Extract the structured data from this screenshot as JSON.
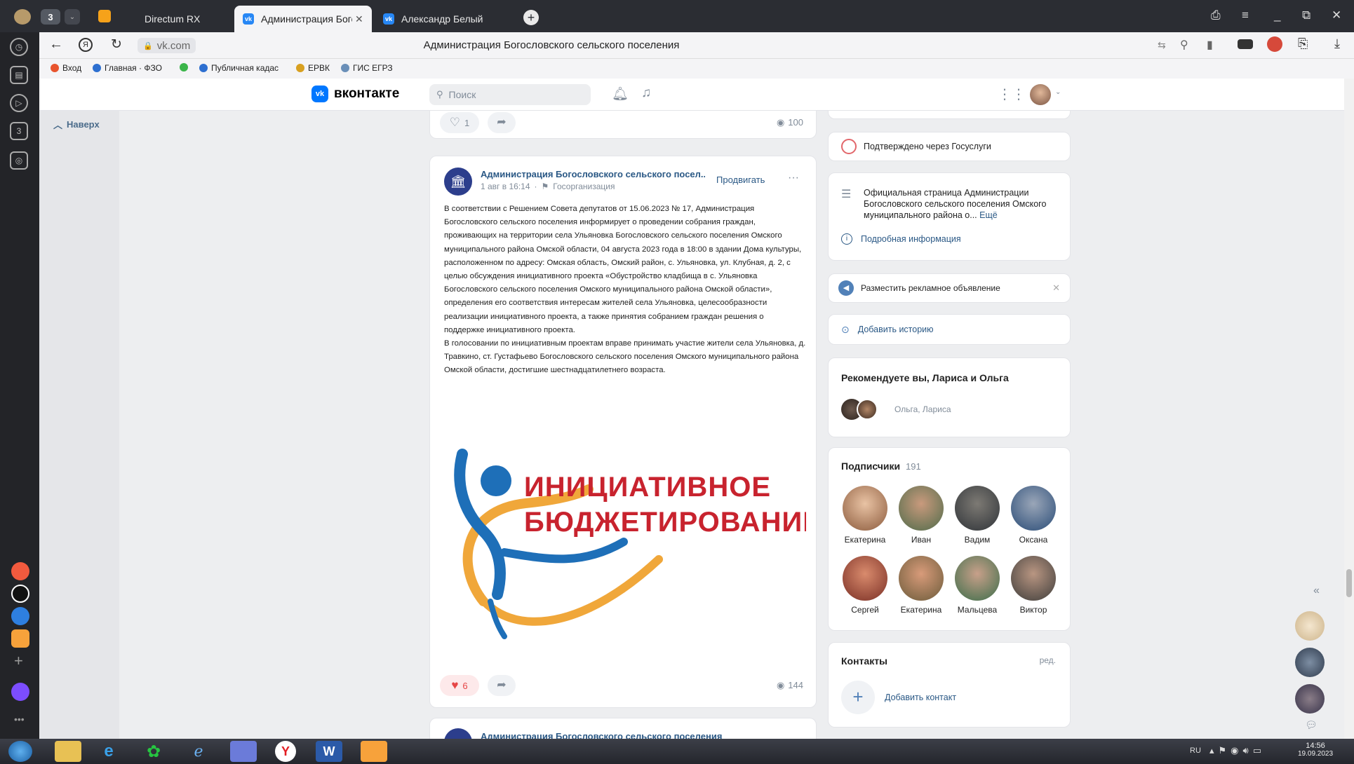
{
  "browser": {
    "tab_count_badge": "3",
    "tabs": [
      {
        "label": "Directum RX",
        "active": false
      },
      {
        "label": "Администрация Богосл",
        "active": true
      },
      {
        "label": "Александр Белый",
        "active": false
      }
    ],
    "address": "vk.com",
    "page_title": "Администрация Богословского сельского поселения",
    "sidebar_badge": "3"
  },
  "bookmarks": [
    {
      "label": "Вход",
      "color": "#e8542e"
    },
    {
      "label": "Главная · ФЗО",
      "color": "#2d6fd0"
    },
    {
      "label": "",
      "color": "#3bb54a"
    },
    {
      "label": "Публичная кадас",
      "color": "#2d6fd0"
    },
    {
      "label": "ЕРВК",
      "color": "#d8a020"
    },
    {
      "label": "ГИС ЕГРЗ",
      "color": "#6a8fb8"
    }
  ],
  "vk": {
    "logo_text": "вконтакте",
    "search_placeholder": "Поиск",
    "scroll_up": "Наверх"
  },
  "prev_post": {
    "likes": "1",
    "views": "100"
  },
  "post": {
    "author": "Администрация Богословского сельского посел...",
    "date": "1 авг в 16:14",
    "category": "Госорганизация",
    "promote": "Продвигать",
    "text1": "В соответствии с Решением Совета депутатов от 15.06.2023 № 17, Администрация Богословского сельского поселения информирует о проведении собрания граждан, проживающих на территории села Ульяновка Богословского сельского поселения Омского муниципального района Омской области, 04 августа 2023 года в 18:00 в здании Дома культуры, расположенном по адресу: Омская область, Омский район, с. Ульяновка, ул. Клубная, д. 2, с целью обсуждения инициативного проекта «Обустройство кладбища в с. Ульяновка Богословского сельского поселения Омского муниципального района Омской области», определения его соответствия интересам жителей села Ульяновка, целесообразности реализации инициативного проекта, а также принятия собранием граждан решения о поддержке инициативного проекта.",
    "text2": "В голосовании по инициативным проектам вправе принимать участие жители села Ульяновка, д. Травкино, ст. Густафьево Богословского сельского поселения Омского муниципального района Омской области, достигшие шестнадцатилетнего возраста.",
    "image_line1": "ИНИЦИАТИВНОЕ",
    "image_line2": "БЮДЖЕТИРОВАНИЕ",
    "likes": "6",
    "views": "144"
  },
  "next_post": {
    "author": "Администрация Богословского сельского поселения"
  },
  "right": {
    "verified": "Подтверждено через Госуслуги",
    "about": "Официальная страница Администрации Богословского сельского поселения Омского муниципального района о...",
    "about_more": "Ещё",
    "details": "Подробная информация",
    "ad": "Разместить рекламное объявление",
    "story": "Добавить историю",
    "recommend_title": "Рекомендуете вы, Лариса и Ольга",
    "recommend_names": "Ольга, Лариса",
    "subscribers_title": "Подписчики",
    "subscribers_count": "191",
    "subscribers": [
      "Екатерина",
      "Иван",
      "Вадим",
      "Оксана",
      "Сергей",
      "Екатерина",
      "Мальцева",
      "Виктор"
    ],
    "contacts_title": "Контакты",
    "contacts_edit": "ред.",
    "add_contact": "Добавить контакт"
  },
  "tray": {
    "lang": "RU",
    "time": "14:56",
    "date": "19.09.2023"
  }
}
